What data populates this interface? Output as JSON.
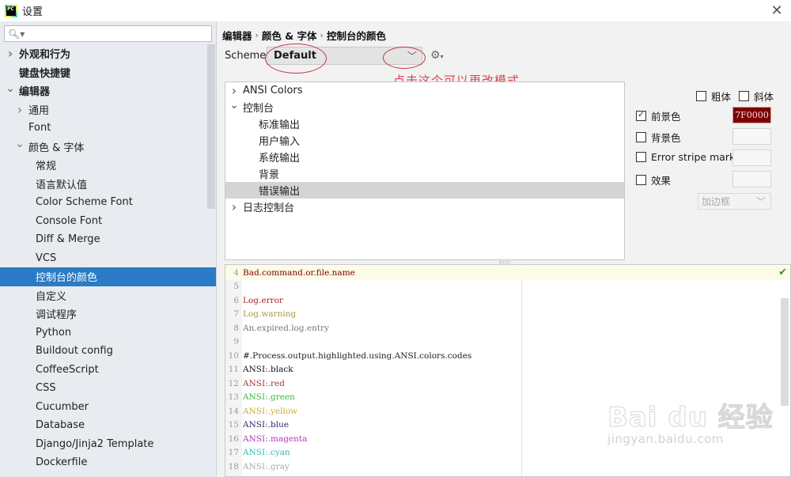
{
  "window": {
    "title": "设置",
    "app_icon": "pycharm-logo-icon",
    "close_icon": "close-icon"
  },
  "sidebar": {
    "search_placeholder": "",
    "search_icon": "search-icon",
    "items": [
      {
        "label": "外观和行为",
        "level": 0,
        "expander": "collapsed",
        "bold": true
      },
      {
        "label": "键盘快捷键",
        "level": 0,
        "expander": "none",
        "bold": true
      },
      {
        "label": "编辑器",
        "level": 0,
        "expander": "expanded",
        "bold": true
      },
      {
        "label": "通用",
        "level": 1,
        "expander": "collapsed",
        "bold": false
      },
      {
        "label": "Font",
        "level": 1,
        "expander": "none",
        "bold": false
      },
      {
        "label": "颜色 & 字体",
        "level": 1,
        "expander": "expanded",
        "bold": false
      },
      {
        "label": "常规",
        "level": 2,
        "expander": "none",
        "bold": false
      },
      {
        "label": "语言默认值",
        "level": 2,
        "expander": "none",
        "bold": false
      },
      {
        "label": "Color Scheme Font",
        "level": 2,
        "expander": "none",
        "bold": false
      },
      {
        "label": "Console Font",
        "level": 2,
        "expander": "none",
        "bold": false
      },
      {
        "label": "Diff & Merge",
        "level": 2,
        "expander": "none",
        "bold": false
      },
      {
        "label": "VCS",
        "level": 2,
        "expander": "none",
        "bold": false
      },
      {
        "label": "控制台的颜色",
        "level": 2,
        "expander": "none",
        "bold": false,
        "selected": true
      },
      {
        "label": "自定义",
        "level": 2,
        "expander": "none",
        "bold": false
      },
      {
        "label": "调试程序",
        "level": 2,
        "expander": "none",
        "bold": false
      },
      {
        "label": "Python",
        "level": 2,
        "expander": "none",
        "bold": false
      },
      {
        "label": "Buildout config",
        "level": 2,
        "expander": "none",
        "bold": false
      },
      {
        "label": "CoffeeScript",
        "level": 2,
        "expander": "none",
        "bold": false
      },
      {
        "label": "CSS",
        "level": 2,
        "expander": "none",
        "bold": false
      },
      {
        "label": "Cucumber",
        "level": 2,
        "expander": "none",
        "bold": false
      },
      {
        "label": "Database",
        "level": 2,
        "expander": "none",
        "bold": false
      },
      {
        "label": "Django/Jinja2 Template",
        "level": 2,
        "expander": "none",
        "bold": false
      },
      {
        "label": "Dockerfile",
        "level": 2,
        "expander": "none",
        "bold": false
      }
    ]
  },
  "breadcrumb": [
    "编辑器",
    "颜色 & 字体",
    "控制台的颜色"
  ],
  "scheme": {
    "label": "Scheme:",
    "value": "Default",
    "gear_icon": "gear-icon"
  },
  "annotation": {
    "text": "点击这个可以更改模式",
    "color": "#d0484f"
  },
  "element_tree": [
    {
      "label": "ANSI Colors",
      "child": false,
      "expander": "collapsed"
    },
    {
      "label": "控制台",
      "child": false,
      "expander": "expanded"
    },
    {
      "label": "标准输出",
      "child": true,
      "expander": "none"
    },
    {
      "label": "用户输入",
      "child": true,
      "expander": "none"
    },
    {
      "label": "系统输出",
      "child": true,
      "expander": "none"
    },
    {
      "label": "背景",
      "child": true,
      "expander": "none"
    },
    {
      "label": "错误输出",
      "child": true,
      "expander": "none",
      "selected": true
    },
    {
      "label": "日志控制台",
      "child": false,
      "expander": "collapsed"
    }
  ],
  "attributes": {
    "bold": {
      "label": "粗体",
      "checked": false
    },
    "italic": {
      "label": "斜体",
      "checked": false
    },
    "foreground": {
      "label": "前景色",
      "checked": true,
      "value": "7F0000",
      "color": "#7f0000"
    },
    "background": {
      "label": "背景色",
      "checked": false,
      "value": ""
    },
    "error_stripe": {
      "label": "Error stripe mark",
      "checked": false,
      "value": ""
    },
    "effects": {
      "label": "效果",
      "checked": false,
      "value": ""
    },
    "effect_type": "加边框"
  },
  "preview": {
    "lines": [
      {
        "num": "4",
        "text": "Bad.command.or.file.name",
        "color": "#7f0000",
        "current": true
      },
      {
        "num": "5",
        "text": "",
        "color": "#000000"
      },
      {
        "num": "6",
        "text": "Log.error",
        "color": "#a6262c"
      },
      {
        "num": "7",
        "text": "Log.warning",
        "color": "#a99a36"
      },
      {
        "num": "8",
        "text": "An.expired.log.entry",
        "color": "#777777"
      },
      {
        "num": "9",
        "text": "",
        "color": "#000000"
      },
      {
        "num": "10",
        "text": "#.Process.output.highlighted.using.ANSI.colors.codes",
        "color": "#222222"
      },
      {
        "num": "11",
        "text": "ANSI:.black",
        "color": "#111111"
      },
      {
        "num": "12",
        "text": "ANSI:.red",
        "color": "#a13a3a"
      },
      {
        "num": "13",
        "text": "ANSI:.green",
        "color": "#3bb545"
      },
      {
        "num": "14",
        "text": "ANSI:.yellow",
        "color": "#c9b02f"
      },
      {
        "num": "15",
        "text": "ANSI:.blue",
        "color": "#2c2c6e"
      },
      {
        "num": "16",
        "text": "ANSI:.magenta",
        "color": "#b13bb8"
      },
      {
        "num": "17",
        "text": "ANSI:.cyan",
        "color": "#3cb8b8"
      },
      {
        "num": "18",
        "text": "ANSI:.gray",
        "color": "#aaaaaa"
      }
    ],
    "status_icon": "inspection-ok-icon"
  },
  "watermark": {
    "brand": "Bai du 经验",
    "url": "jingyan.baidu.com"
  },
  "colors": {
    "selection": "#2a7ac5",
    "sidebar_bg": "#e8ebef",
    "foreground_swatch": "#7f0000"
  }
}
